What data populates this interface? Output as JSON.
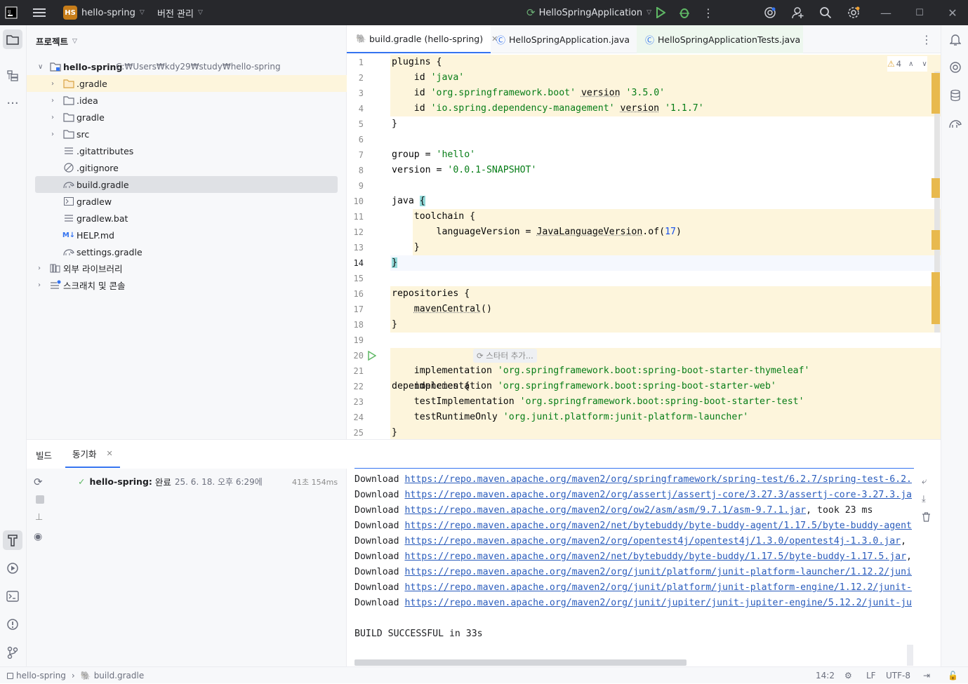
{
  "titlebar": {
    "project_badge": "HS",
    "project_name": "hello-spring",
    "vcs_menu": "버전 관리",
    "run_config": "HelloSpringApplication"
  },
  "project_panel": {
    "title": "프로젝트",
    "root_name": "hello-spring",
    "root_path": "C:₩Users₩kdy29₩study₩hello-spring",
    "items": [
      {
        "label": ".gradle"
      },
      {
        "label": ".idea"
      },
      {
        "label": "gradle"
      },
      {
        "label": "src"
      },
      {
        "label": ".gitattributes"
      },
      {
        "label": ".gitignore"
      },
      {
        "label": "build.gradle"
      },
      {
        "label": "gradlew"
      },
      {
        "label": "gradlew.bat"
      },
      {
        "label": "HELP.md"
      },
      {
        "label": "settings.gradle"
      },
      {
        "label": "외부 라이브러리"
      },
      {
        "label": "스크래치 및 콘솔"
      }
    ],
    "md_badge": "M↓"
  },
  "tabs": [
    {
      "label": "build.gradle (hello-spring)"
    },
    {
      "label": "HelloSpringApplication.java"
    },
    {
      "label": "HelloSpringApplicationTests.java"
    }
  ],
  "editor": {
    "warning_count": "4",
    "inlay_hint": "스타터 추가...",
    "lines": [
      {
        "n": "1"
      },
      {
        "n": "2"
      },
      {
        "n": "3"
      },
      {
        "n": "4"
      },
      {
        "n": "5"
      },
      {
        "n": "6"
      },
      {
        "n": "7"
      },
      {
        "n": "8"
      },
      {
        "n": "9"
      },
      {
        "n": "10"
      },
      {
        "n": "11"
      },
      {
        "n": "12"
      },
      {
        "n": "13"
      },
      {
        "n": "14"
      },
      {
        "n": "15"
      },
      {
        "n": "16"
      },
      {
        "n": "17"
      },
      {
        "n": "18"
      },
      {
        "n": "19"
      },
      {
        "n": "20"
      },
      {
        "n": "21"
      },
      {
        "n": "22"
      },
      {
        "n": "23"
      },
      {
        "n": "24"
      },
      {
        "n": "25"
      }
    ],
    "code": {
      "l1": "plugins {",
      "l2a": "    id ",
      "l2b": "'java'",
      "l3a": "    id ",
      "l3b": "'org.springframework.boot'",
      "l3c": " ",
      "l3d": "version",
      "l3e": " ",
      "l3f": "'3.5.0'",
      "l4a": "    id ",
      "l4b": "'io.spring.dependency-management'",
      "l4c": " ",
      "l4d": "version",
      "l4e": " ",
      "l4f": "'1.1.7'",
      "l5": "}",
      "l7a": "group = ",
      "l7b": "'hello'",
      "l8a": "version = ",
      "l8b": "'0.0.1-SNAPSHOT'",
      "l10a": "java ",
      "l10b": "{",
      "l11": "    toolchain {",
      "l12a": "        languageVersion = ",
      "l12b": "JavaLanguageVersion",
      "l12c": ".of(",
      "l12d": "17",
      "l12e": ")",
      "l13": "    }",
      "l14": "}",
      "l16": "repositories {",
      "l17a": "    ",
      "l17b": "mavenCentral",
      "l17c": "()",
      "l18": "}",
      "l20": "dependencies {",
      "l21a": "    implementation ",
      "l21b": "'org.springframework.boot:spring-boot-starter-thymeleaf'",
      "l22a": "    implementation ",
      "l22b": "'org.springframework.boot:spring-boot-starter-web'",
      "l23a": "    testImplementation ",
      "l23b": "'org.springframework.boot:spring-boot-starter-test'",
      "l24a": "    testRuntimeOnly ",
      "l24b": "'org.junit.platform:junit-platform-launcher'",
      "l25": "}"
    }
  },
  "bottom": {
    "tab_build": "빌드",
    "tab_sync": "동기화",
    "sync_item_name": "hello-spring:",
    "sync_item_status": "완료",
    "sync_item_time": "25. 6. 18. 오후 6:29에",
    "sync_item_duration": "41초 154ms",
    "output": [
      {
        "prefix": "Download ",
        "link": "https://repo.maven.apache.org/maven2/org/springframework/spring-test/6.2.7/spring-test-6.2.",
        "suffix": ""
      },
      {
        "prefix": "Download ",
        "link": "https://repo.maven.apache.org/maven2/org/assertj/assertj-core/3.27.3/assertj-core-3.27.3.ja",
        "suffix": ""
      },
      {
        "prefix": "Download ",
        "link": "https://repo.maven.apache.org/maven2/org/ow2/asm/asm/9.7.1/asm-9.7.1.jar",
        "suffix": ", took 23 ms"
      },
      {
        "prefix": "Download ",
        "link": "https://repo.maven.apache.org/maven2/net/bytebuddy/byte-buddy-agent/1.17.5/byte-buddy-agent",
        "suffix": ""
      },
      {
        "prefix": "Download ",
        "link": "https://repo.maven.apache.org/maven2/org/opentest4j/opentest4j/1.3.0/opentest4j-1.3.0.jar",
        "suffix": ","
      },
      {
        "prefix": "Download ",
        "link": "https://repo.maven.apache.org/maven2/net/bytebuddy/byte-buddy/1.17.5/byte-buddy-1.17.5.jar",
        "suffix": ","
      },
      {
        "prefix": "Download ",
        "link": "https://repo.maven.apache.org/maven2/org/junit/platform/junit-platform-launcher/1.12.2/juni",
        "suffix": ""
      },
      {
        "prefix": "Download ",
        "link": "https://repo.maven.apache.org/maven2/org/junit/platform/junit-platform-engine/1.12.2/junit-",
        "suffix": ""
      },
      {
        "prefix": "Download ",
        "link": "https://repo.maven.apache.org/maven2/org/junit/jupiter/junit-jupiter-engine/5.12.2/junit-ju",
        "suffix": ""
      }
    ],
    "build_result": "BUILD SUCCESSFUL in 33s"
  },
  "statusbar": {
    "crumb_project": "hello-spring",
    "crumb_file": "build.gradle",
    "position": "14:2",
    "line_separator": "LF",
    "encoding": "UTF-8"
  }
}
